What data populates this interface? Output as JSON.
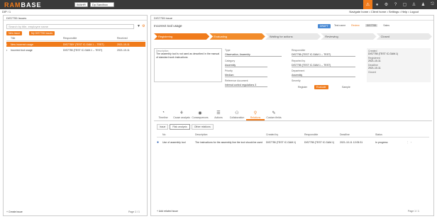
{
  "app": {
    "logo_a": "RAM",
    "logo_b": "BASE",
    "company": "IMAHR",
    "user": "Dp.Sandbox"
  },
  "topbar": {
    "icons": [
      "warning-icon",
      "bell-icon",
      "gear-icon",
      "help-icon",
      "chat-icon",
      "user-icon",
      "user-add-icon",
      "logout-icon"
    ]
  },
  "subbar": {
    "left": "DIP / 1",
    "links": "Navigate home  •  Client home  •  Settings  •  Help  •  Logout"
  },
  "left": {
    "title": "DIS7755 Issues",
    "search_placeholder": "Search by title, employee name",
    "btn_new": "New issue",
    "btn_filter": "My DIS7755 issues",
    "columns": [
      "",
      "Title",
      "Responsible",
      "Received"
    ],
    "rows": [
      {
        "title": "New incorrect usage",
        "resp": "DIS7755Y (TEST IC.GAM.1 -- TEST)",
        "date": "2021-10-11",
        "selected": true
      },
      {
        "title": "Incorrect tool usage",
        "resp": "DIS7755 (TEST IC.GAM.1 -- TEST)",
        "date": "2021-10-11",
        "selected": false
      }
    ],
    "footer_add": "+ Create issue",
    "footer_page": "Page 1 / 1"
  },
  "right": {
    "title": "DIS7755 issue",
    "issue_title": "Incorrect tool usage",
    "status_badge": "DRAFT",
    "chips": [
      "Test name",
      "Review",
      "DIS7755",
      "Sales"
    ],
    "steps": [
      "Registering",
      "Evaluating",
      "Waiting for actions",
      "Reviewing",
      "Closed"
    ],
    "description_label": "Description",
    "description": "The assembly tool is not used as described in the manual of standard work instructions",
    "fields": {
      "type_label": "Type",
      "type_value": "Observation, Assembly",
      "category_label": "Category",
      "category_value": "Assembly",
      "priority_label": "Priority",
      "priority_value": "Medium",
      "resp_label": "Responsible",
      "resp_value": "DIS7755 (TEST IC.GAM.1 -- TEST)",
      "reported_label": "Reported by",
      "reported_value": "DIS7755 (TEST IC.GAM.1 -- TEST)",
      "department_label": "Department",
      "department_value": "Assembly",
      "severity_label": "Severity",
      "severity_value": "Medium",
      "ref_label": "Reference document",
      "ref_value": "Internal control regulations 3",
      "category2_label": "Category",
      "category2_value": "Assembly",
      "assigned_label": "Assigned",
      "assigned_value": "Employee",
      "sample_label": "Sample",
      "sample_value": "Sample"
    },
    "side": {
      "created_label": "Created",
      "created_value": "DIS7755 (TEST IC.GAM.1)",
      "registered_label": "Registered",
      "registered_value": "2021-10-11",
      "deadline_label": "Deadline",
      "deadline_value": "2021-10-11",
      "closed_label": "Closed",
      "closed_value": ""
    },
    "tabs": [
      {
        "icon": "timeline-icon",
        "glyph": "◔",
        "label": "Timeline"
      },
      {
        "icon": "analysis-icon",
        "glyph": "⚘",
        "label": "Cause analysis"
      },
      {
        "icon": "consequence-icon",
        "glyph": "◉",
        "label": "Consequences"
      },
      {
        "icon": "actions-icon",
        "glyph": "☰",
        "label": "Actions"
      },
      {
        "icon": "collaboration-icon",
        "glyph": "⚇",
        "label": "Collaboration"
      },
      {
        "icon": "relations-icon",
        "glyph": "⚲",
        "label": "Relations"
      },
      {
        "icon": "custom-icon",
        "glyph": "✎",
        "label": "Custom fields"
      }
    ],
    "subtabs": [
      "Issue",
      "Risk analysis",
      "Other relations"
    ],
    "table_cols": [
      "",
      "No",
      "Description",
      "Created by",
      "Responsible",
      "Deadline",
      "Status"
    ],
    "table_row": {
      "no": "Use of assembly tool",
      "desc": "The instructions for the assembly line the tool should be used",
      "created": "DIS7755 (TEST IC.GAM.1)",
      "resp": "DIS7755 (TEST IC.GAM.1)",
      "deadline": "2021-10-11 12:05:31",
      "status": "In progress"
    },
    "footer_add": "+ Add related issue",
    "footer_page": "Page 1 / 1",
    "btn_register": "Register",
    "btn_evaluate": "Evaluate",
    "btn_sample": "Sample"
  }
}
